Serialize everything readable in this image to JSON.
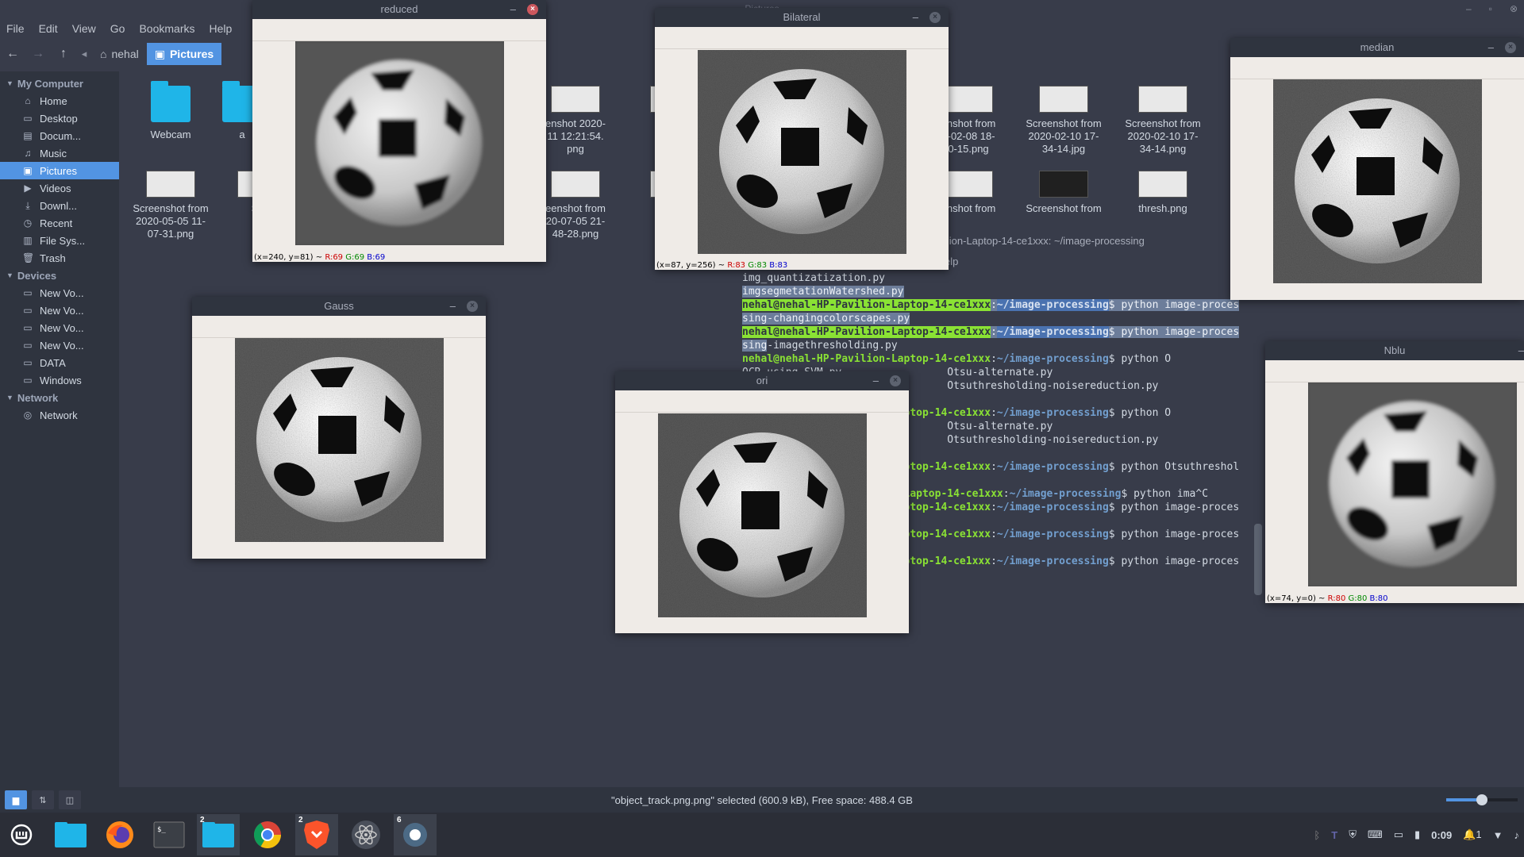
{
  "window_title": "Pictures",
  "menubar": [
    "File",
    "Edit",
    "View",
    "Go",
    "Bookmarks",
    "Help"
  ],
  "breadcrumbs": {
    "home": "nehal",
    "current": "Pictures"
  },
  "sidebar": {
    "sections": [
      {
        "title": "My Computer",
        "items": [
          {
            "label": "Home",
            "icon": "home-icon"
          },
          {
            "label": "Desktop",
            "icon": "desktop-icon"
          },
          {
            "label": "Docum...",
            "icon": "documents-icon"
          },
          {
            "label": "Music",
            "icon": "music-icon"
          },
          {
            "label": "Pictures",
            "icon": "pictures-icon",
            "active": true
          },
          {
            "label": "Videos",
            "icon": "videos-icon"
          },
          {
            "label": "Downl...",
            "icon": "downloads-icon"
          },
          {
            "label": "Recent",
            "icon": "recent-icon"
          },
          {
            "label": "File Sys...",
            "icon": "filesystem-icon"
          },
          {
            "label": "Trash",
            "icon": "trash-icon"
          }
        ]
      },
      {
        "title": "Devices",
        "items": [
          {
            "label": "New Vo...",
            "icon": "drive-icon"
          },
          {
            "label": "New Vo...",
            "icon": "drive-icon"
          },
          {
            "label": "New Vo...",
            "icon": "drive-icon"
          },
          {
            "label": "New Vo...",
            "icon": "drive-icon"
          },
          {
            "label": "DATA",
            "icon": "drive-icon"
          },
          {
            "label": "Windows",
            "icon": "drive-icon"
          }
        ]
      },
      {
        "title": "Network",
        "items": [
          {
            "label": "Network",
            "icon": "network-icon"
          }
        ]
      }
    ]
  },
  "files": [
    {
      "name": "Webcam",
      "type": "folder"
    },
    {
      "name": "a",
      "type": "folder"
    },
    {
      "name": "enshot 2020-\n11 12:21:54.\npng",
      "type": "image"
    },
    {
      "name": "Scree\n2020\n24",
      "type": "image"
    },
    {
      "name": "enshot from\n0-02-08 18-\n0-15.png",
      "type": "image"
    },
    {
      "name": "Screenshot from\n2020-02-10 17-\n34-14.jpg",
      "type": "image"
    },
    {
      "name": "Screenshot from\n2020-02-10 17-\n34-14.png",
      "type": "image"
    },
    {
      "name": "S\n2",
      "type": "image"
    },
    {
      "name": "Screenshot from\n2020-05-05 11-\n07-31.png",
      "type": "image"
    },
    {
      "name": "Scre\n202",
      "type": "image"
    },
    {
      "name": "eenshot from\n20-07-05 21-\n48-28.png",
      "type": "image"
    },
    {
      "name": "Scree\n2020\n49",
      "type": "image"
    },
    {
      "name": "enshot from",
      "type": "image"
    },
    {
      "name": "Screenshot from",
      "type": "image-dark"
    },
    {
      "name": "thresh.png",
      "type": "image"
    }
  ],
  "status": {
    "text": "\"object_track.png.png\" selected (600.9 kB), Free space: 488.4 GB",
    "zoom_fraction": 0.5
  },
  "terminal": {
    "title": "ilion-Laptop-14-ce1xxx: ~/image-processing",
    "menu": "elp",
    "user": "nehal@nehal-HP-Pavilion-Laptop-14-ce1xxx",
    "user_frag1": "ptop-14-ce1xxx",
    "user_frag2": "Laptop-14-ce1xxx",
    "path": "~/image-processing",
    "lines": [
      "img_quantizatization.py",
      "imgsegmetationWatershed.py",
      "sing-changingcolorscapes.py",
      "sing-imagethresholding.py",
      "OCR-using-SVM.py",
      "Otsu-alternate.py",
      "Otsuthresholding-noisereduction.py"
    ],
    "cmds": [
      "$ python image-proces",
      "$ python image-proces",
      "$ python O",
      "$ python O",
      "$ python Otsuthreshol",
      "$ python ima^C",
      "$ python image-proces",
      "$ python image-proces",
      "$ python image-proces"
    ]
  },
  "cv_windows": {
    "reduced": {
      "title": "reduced",
      "status_pre": "(x=240, y=81) ~ ",
      "r": "R:69",
      "g": "G:69",
      "b": "B:69"
    },
    "bilateral": {
      "title": "Bilateral",
      "status_pre": "(x=87, y=256) ~ ",
      "r": "R:83",
      "g": "G:83",
      "b": "B:83"
    },
    "median": {
      "title": "median"
    },
    "gauss": {
      "title": "Gauss"
    },
    "ori": {
      "title": "ori"
    },
    "nblu": {
      "title": "Nblu",
      "status_pre": "(x=74, y=0) ~ ",
      "r": "R:80",
      "g": "G:80",
      "b": "B:80"
    }
  },
  "taskbar": {
    "apps": [
      {
        "name": "mint-menu",
        "badge": ""
      },
      {
        "name": "files-folder",
        "badge": ""
      },
      {
        "name": "firefox",
        "badge": ""
      },
      {
        "name": "terminal",
        "badge": ""
      },
      {
        "name": "files",
        "badge": "2"
      },
      {
        "name": "chrome",
        "badge": ""
      },
      {
        "name": "brave",
        "badge": "2"
      },
      {
        "name": "atom",
        "badge": ""
      },
      {
        "name": "python",
        "badge": "6"
      }
    ],
    "clock": "0:09",
    "notif_count": "1"
  }
}
